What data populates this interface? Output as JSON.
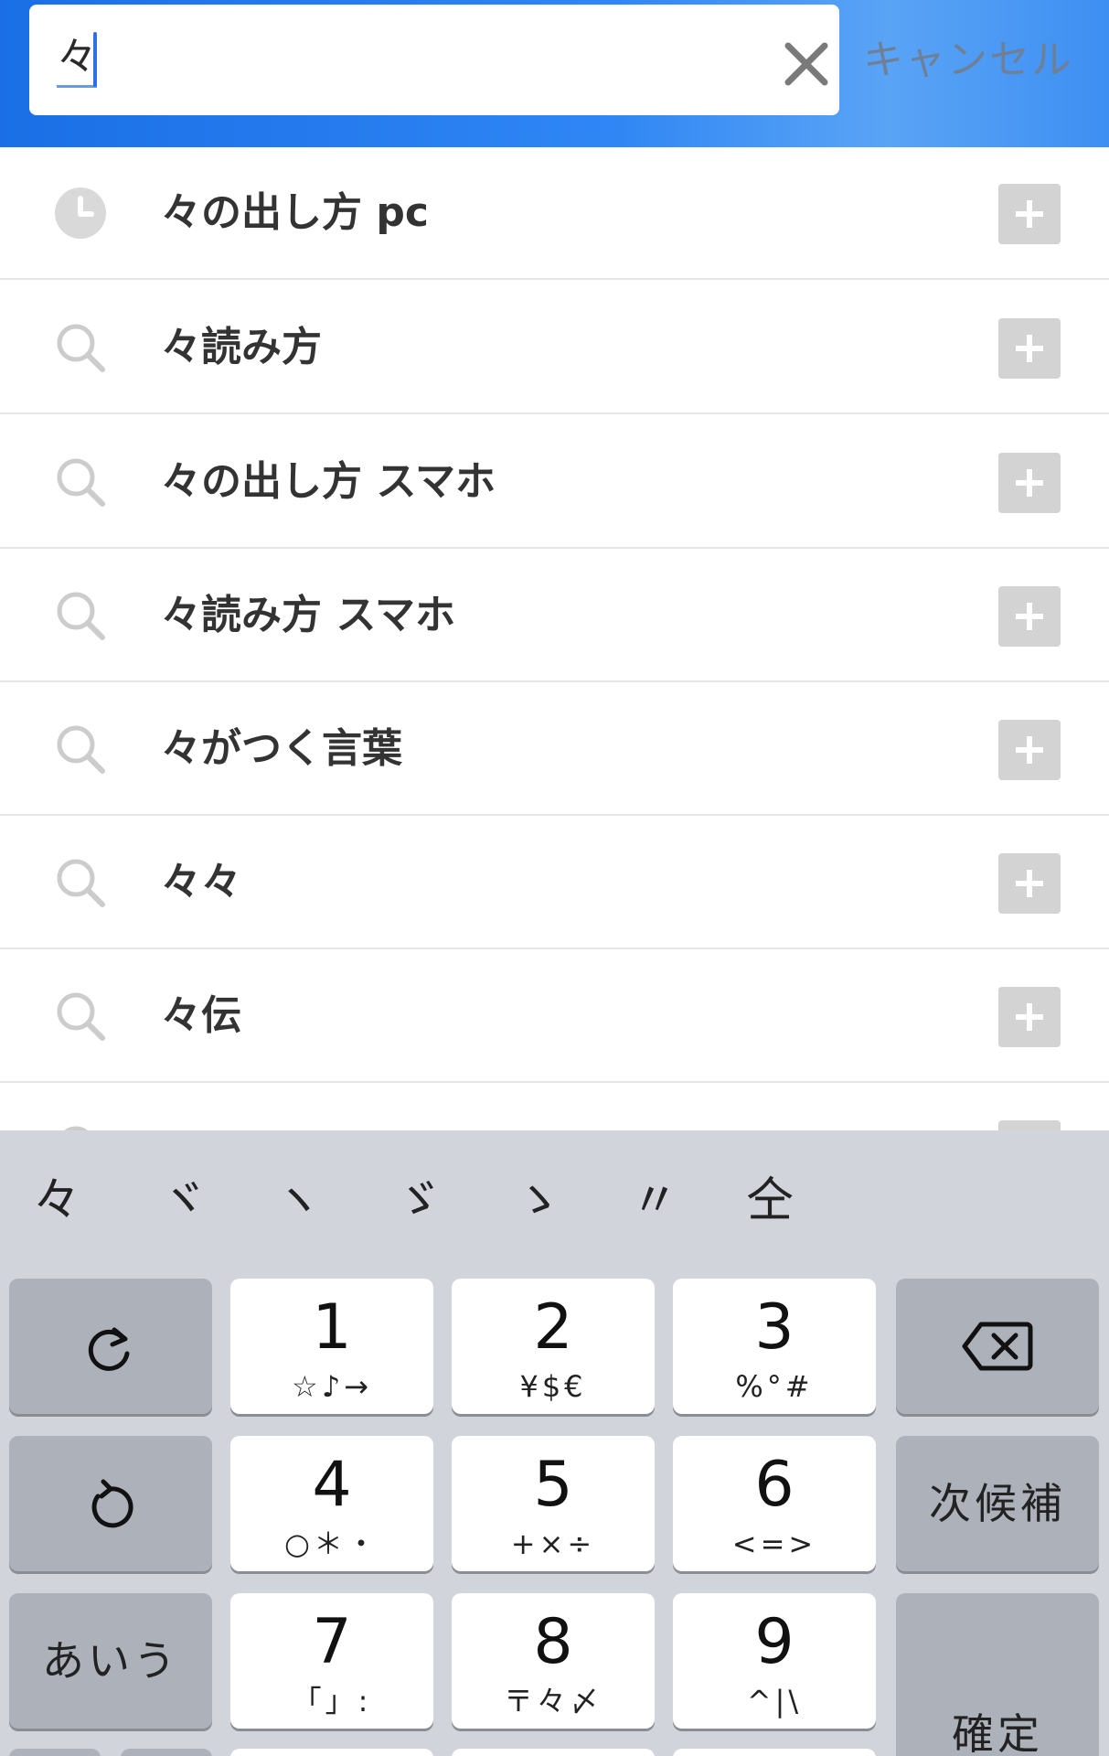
{
  "search": {
    "value": "々",
    "cancel_label": "キャンセル"
  },
  "suggestions": [
    {
      "icon": "history-clock-icon",
      "label": "々の出し方 pc"
    },
    {
      "icon": "search-icon",
      "label": "々読み方"
    },
    {
      "icon": "search-icon",
      "label": "々の出し方 スマホ"
    },
    {
      "icon": "search-icon",
      "label": "々読み方 スマホ"
    },
    {
      "icon": "search-icon",
      "label": "々がつく言葉"
    },
    {
      "icon": "search-icon",
      "label": "々々"
    },
    {
      "icon": "search-icon",
      "label": "々伝"
    }
  ],
  "keyboard": {
    "candidates": [
      "々",
      "ヾ",
      "ヽ",
      "ゞ",
      "ゝ",
      "〃",
      "仝"
    ],
    "keys": {
      "k1": {
        "main": "1",
        "sub": "☆♪→"
      },
      "k2": {
        "main": "2",
        "sub": "¥$€"
      },
      "k3": {
        "main": "3",
        "sub": "%°#"
      },
      "k4": {
        "main": "4",
        "sub": "○＊・"
      },
      "k5": {
        "main": "5",
        "sub": "+×÷"
      },
      "k6": {
        "main": "6",
        "sub": "<=>"
      },
      "k7": {
        "main": "7",
        "sub": "「」:"
      },
      "k8": {
        "main": "8",
        "sub": "〒々〆"
      },
      "k9": {
        "main": "9",
        "sub": "^|\\"
      }
    },
    "next_candidate_label": "次候補",
    "kana_label": "あいう",
    "confirm_label": "確定"
  },
  "colors": {
    "header_blue": "#2f86f4",
    "cancel_text": "#6f7f96",
    "keyboard_bg": "#d1d4da",
    "key_dark": "#acb1ba"
  }
}
